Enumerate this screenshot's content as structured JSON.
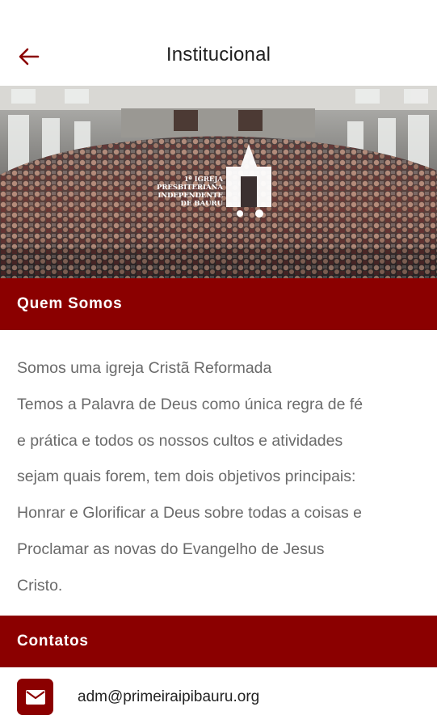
{
  "app_bar": {
    "title": "Institucional",
    "back_icon": "arrow-left-icon",
    "accent_color": "#8b0000"
  },
  "hero": {
    "logo_lines": [
      "1ª IGREJA",
      "PRESBITERIANA",
      "INDEPENDENTE",
      "DE BAURU"
    ]
  },
  "about": {
    "header": "Quem Somos",
    "lines": [
      "Somos uma igreja Cristã Reformada",
      "Temos a Palavra de Deus como única regra de fé",
      "e prática e todos os nossos cultos e atividades",
      "sejam quais forem, tem dois objetivos principais:",
      "Honrar e Glorificar a Deus sobre todas a coisas e",
      "Proclamar as novas do Evangelho de Jesus",
      "Cristo."
    ]
  },
  "contacts": {
    "header": "Contatos",
    "items": [
      {
        "icon": "envelope-icon",
        "value": "adm@primeiraipibauru.org"
      }
    ]
  },
  "colors": {
    "section_header_bg": "#8b0000",
    "body_text": "#6a6a6a"
  }
}
